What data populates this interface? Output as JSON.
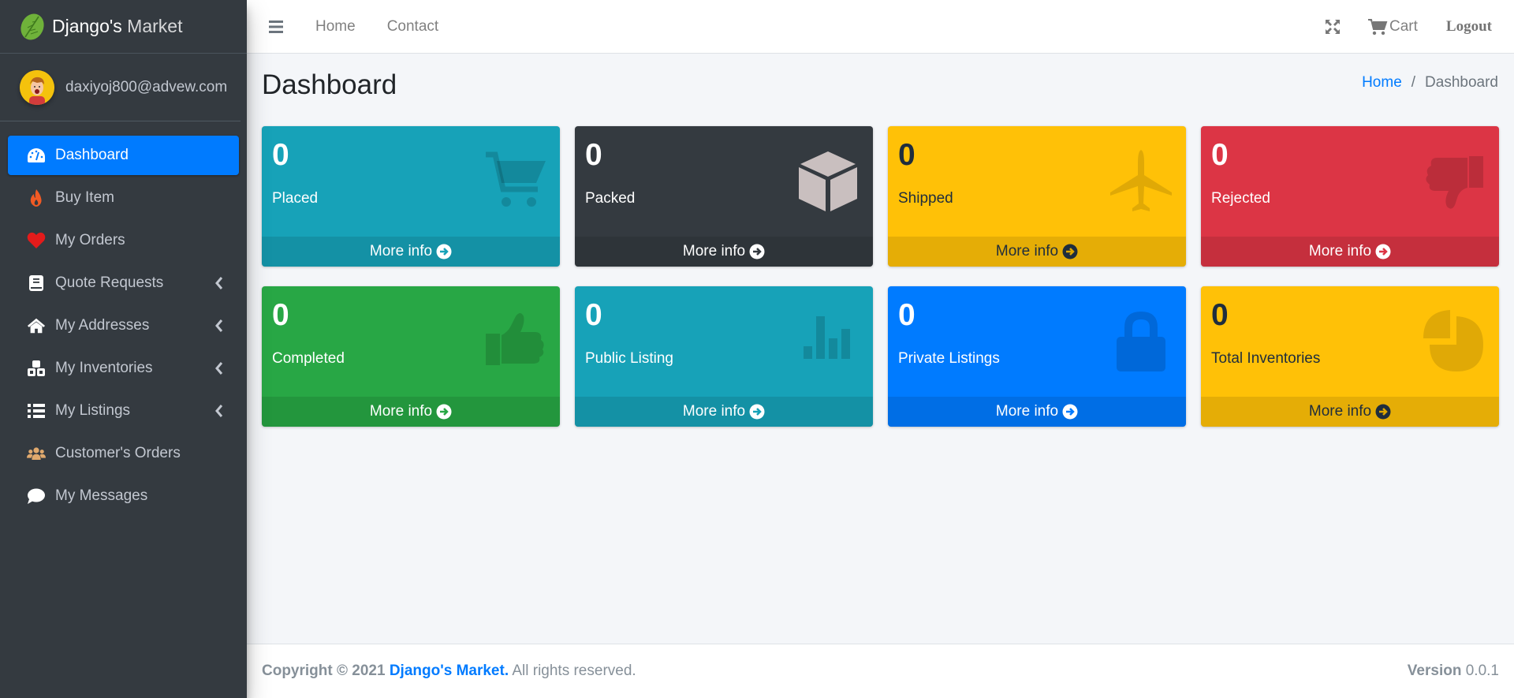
{
  "brand": {
    "name_bold": "Django's",
    "name_light": "Market",
    "logo_icon": "leaf-icon"
  },
  "user": {
    "email": "daxiyoj800@advew.com",
    "avatar_icon": "user-avatar-cartoon"
  },
  "sidebar": {
    "items": [
      {
        "label": "Dashboard",
        "icon": "tachometer-icon",
        "active": true,
        "has_submenu": false
      },
      {
        "label": "Buy Item",
        "icon": "fire-icon",
        "active": false,
        "has_submenu": false
      },
      {
        "label": "My Orders",
        "icon": "heart-icon",
        "active": false,
        "has_submenu": false
      },
      {
        "label": "Quote Requests",
        "icon": "book-icon",
        "active": false,
        "has_submenu": true
      },
      {
        "label": "My Addresses",
        "icon": "home-icon",
        "active": false,
        "has_submenu": true
      },
      {
        "label": "My Inventories",
        "icon": "cubes-icon",
        "active": false,
        "has_submenu": true
      },
      {
        "label": "My Listings",
        "icon": "list-icon",
        "active": false,
        "has_submenu": true
      },
      {
        "label": "Customer's Orders",
        "icon": "users-icon",
        "active": false,
        "has_submenu": false
      },
      {
        "label": "My Messages",
        "icon": "comment-icon",
        "active": false,
        "has_submenu": false
      }
    ]
  },
  "topbar": {
    "links": [
      "Home",
      "Contact"
    ],
    "cart_label": "Cart",
    "logout_label": "Logout"
  },
  "header": {
    "title": "Dashboard",
    "breadcrumb": {
      "home": "Home",
      "separator": "/",
      "current": "Dashboard"
    }
  },
  "boxes": [
    {
      "value": "0",
      "label": "Placed",
      "footer": "More info",
      "icon": "shopping-cart-icon",
      "color": "#17a2b8"
    },
    {
      "value": "0",
      "label": "Packed",
      "footer": "More info",
      "icon": "cube-icon",
      "color": "#343a40"
    },
    {
      "value": "0",
      "label": "Shipped",
      "footer": "More info",
      "icon": "plane-icon",
      "color": "#ffc107"
    },
    {
      "value": "0",
      "label": "Rejected",
      "footer": "More info",
      "icon": "thumbs-down-icon",
      "color": "#dc3545"
    },
    {
      "value": "0",
      "label": "Completed",
      "footer": "More info",
      "icon": "thumbs-up-icon",
      "color": "#28a745"
    },
    {
      "value": "0",
      "label": "Public Listing",
      "footer": "More info",
      "icon": "bar-chart-icon",
      "color": "#17a2b8"
    },
    {
      "value": "0",
      "label": "Private Listings",
      "footer": "More info",
      "icon": "lock-icon",
      "color": "#007bff"
    },
    {
      "value": "0",
      "label": "Total Inventories",
      "footer": "More info",
      "icon": "pie-chart-icon",
      "color": "#ffc107"
    }
  ],
  "footer": {
    "copyright_prefix": "Copyright © 2021",
    "brand_link": "Django's Market.",
    "rights": "All rights reserved.",
    "version_label": "Version",
    "version_value": "0.0.1"
  }
}
